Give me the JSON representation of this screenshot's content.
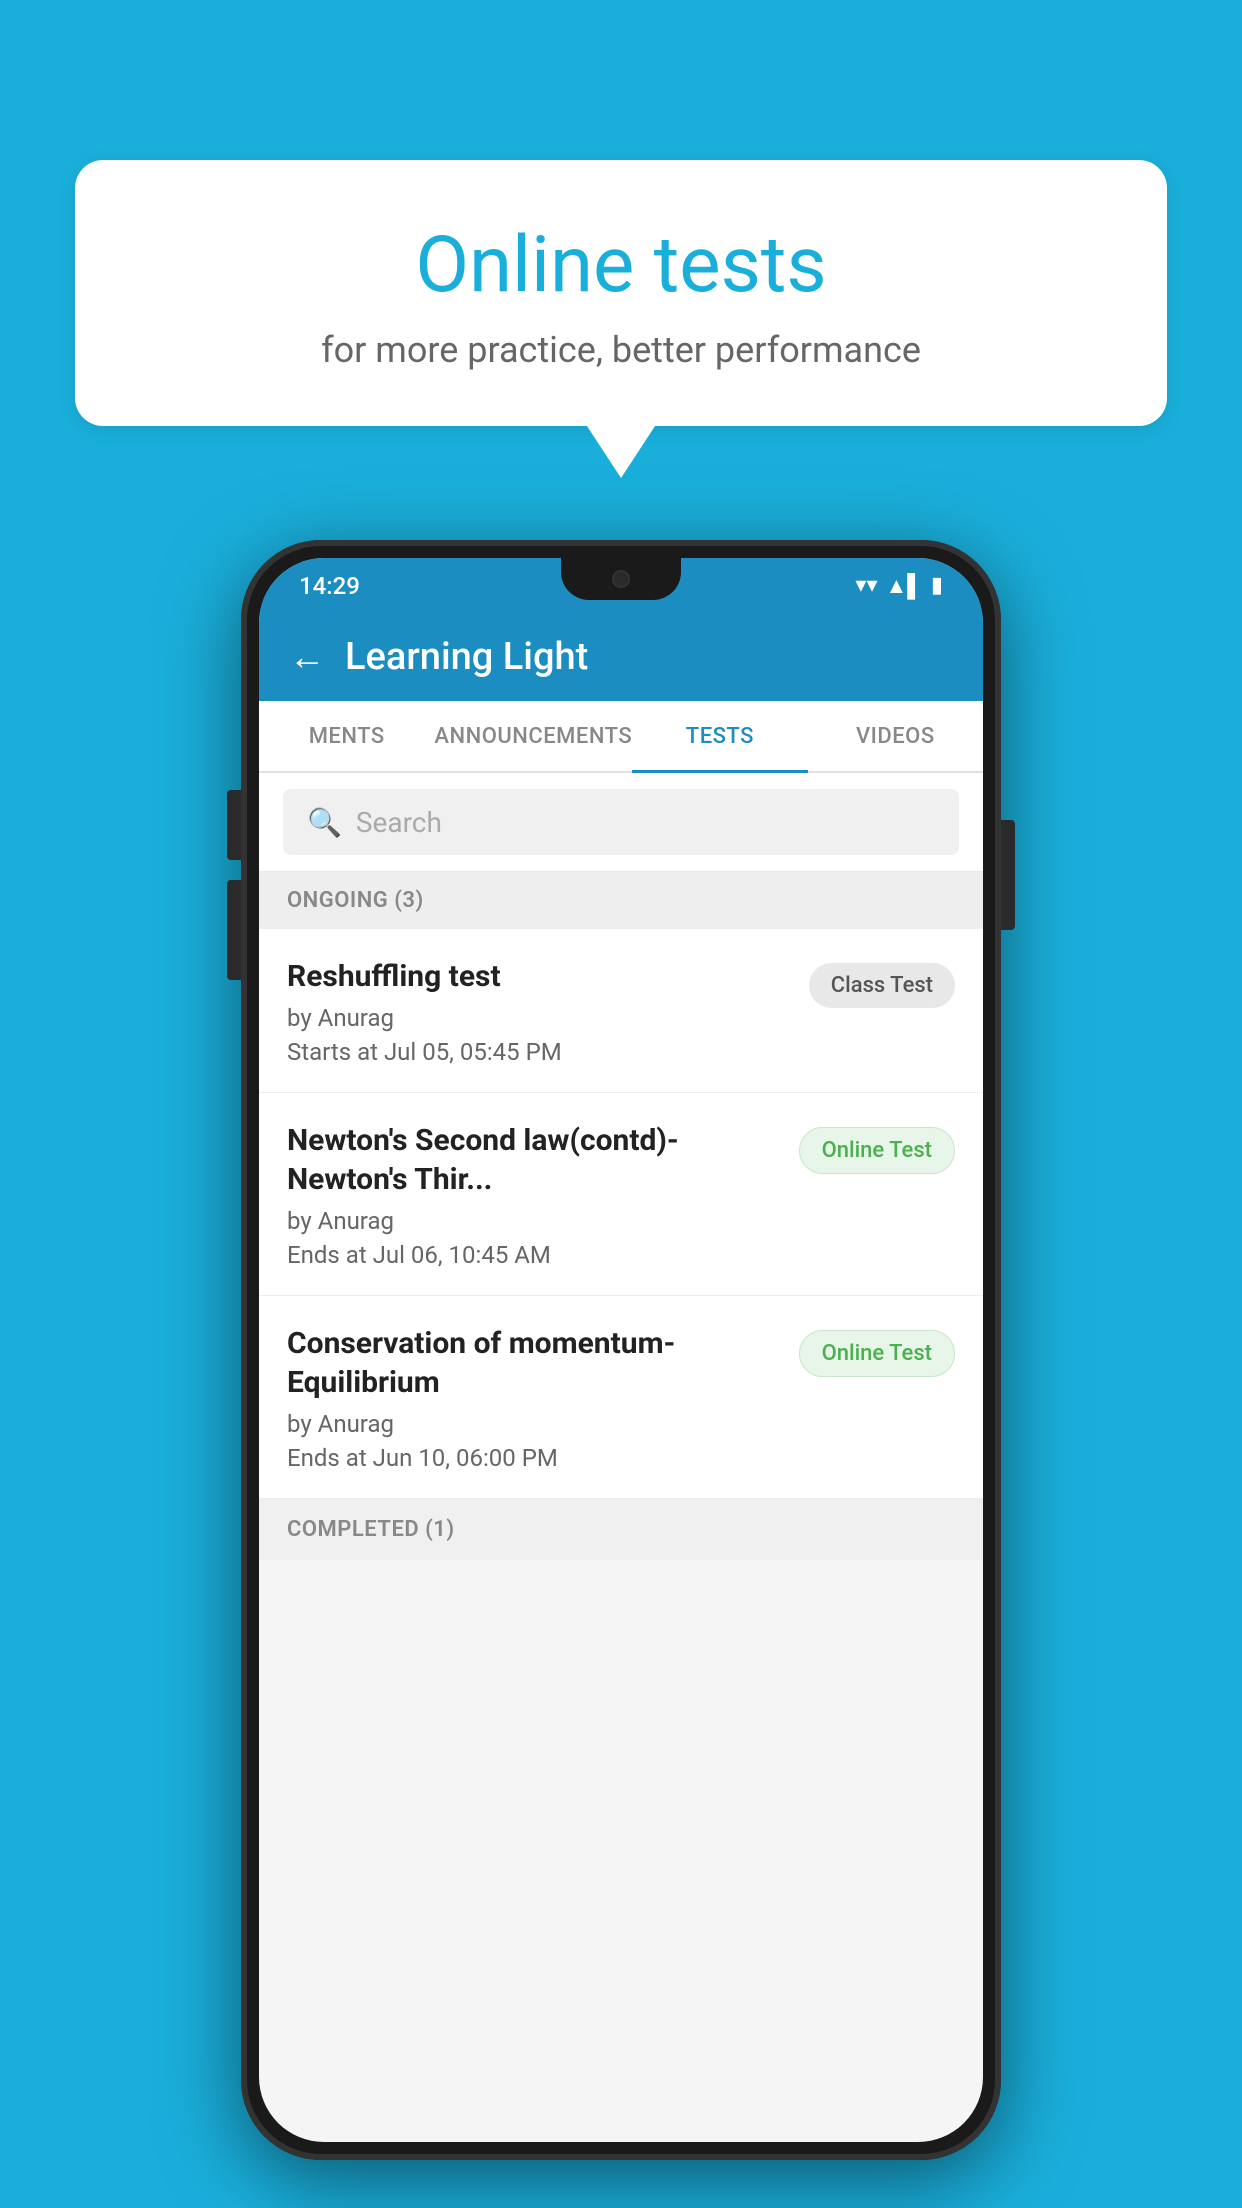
{
  "background_color": "#1AAFDB",
  "speech_bubble": {
    "title": "Online tests",
    "subtitle": "for more practice, better performance"
  },
  "phone": {
    "status_bar": {
      "time": "14:29",
      "wifi": "▾",
      "signal": "▲",
      "battery": "▮"
    },
    "header": {
      "back_label": "←",
      "title": "Learning Light"
    },
    "tabs": [
      {
        "label": "MENTS",
        "active": false
      },
      {
        "label": "ANNOUNCEMENTS",
        "active": false
      },
      {
        "label": "TESTS",
        "active": true
      },
      {
        "label": "VIDEOS",
        "active": false
      }
    ],
    "search": {
      "placeholder": "Search"
    },
    "ongoing_section": {
      "label": "ONGOING (3)"
    },
    "tests": [
      {
        "name": "Reshuffling test",
        "author": "by Anurag",
        "time_label": "Starts at",
        "time": "Jul 05, 05:45 PM",
        "badge": "Class Test",
        "badge_type": "class"
      },
      {
        "name": "Newton's Second law(contd)-Newton's Thir...",
        "author": "by Anurag",
        "time_label": "Ends at",
        "time": "Jul 06, 10:45 AM",
        "badge": "Online Test",
        "badge_type": "online"
      },
      {
        "name": "Conservation of momentum-Equilibrium",
        "author": "by Anurag",
        "time_label": "Ends at",
        "time": "Jun 10, 06:00 PM",
        "badge": "Online Test",
        "badge_type": "online"
      }
    ],
    "completed_section": {
      "label": "COMPLETED (1)"
    }
  }
}
